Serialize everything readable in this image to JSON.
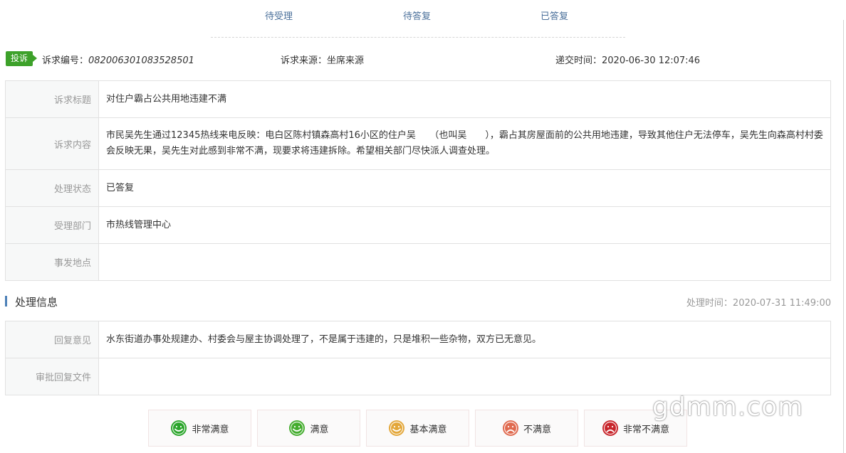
{
  "tabs": [
    "待受理",
    "待答复",
    "已答复"
  ],
  "meta": {
    "badge": "投诉",
    "id_label": "诉求编号：",
    "id_value": "082006301083528501",
    "source": "诉求来源：坐席来源",
    "time": "递交时间：2020-06-30 12:07:46"
  },
  "details": [
    {
      "label": "诉求标题",
      "value": "对住户霸占公共用地违建不满"
    },
    {
      "label": "诉求内容",
      "value": "市民吴先生通过12345热线来电反映：电白区陈村镇森高村16小区的住户吴　　（也叫吴　　），霸占其房屋面前的公共用地违建，导致其他住户无法停车，吴先生向森高村村委会反映无果，吴先生对此感到非常不满，现要求将违建拆除。希望相关部门尽快派人调查处理。"
    },
    {
      "label": "处理状态",
      "value": "已答复"
    },
    {
      "label": "受理部门",
      "value": "市热线管理中心"
    },
    {
      "label": "事发地点",
      "value": ""
    }
  ],
  "processing": {
    "title": "处理信息",
    "time": "处理时间：2020-07-31 11:49:00",
    "rows": [
      {
        "label": "回复意见",
        "value": "水东街道办事处规建办、村委会与屋主协调处理了，不是属于违建的，只是堆积一些杂物，双方已无意见。"
      },
      {
        "label": "审批回复文件",
        "value": ""
      }
    ]
  },
  "ratings": [
    {
      "label": "非常满意",
      "color": "#2aa52a",
      "mouth": "smile"
    },
    {
      "label": "满意",
      "color": "#44ad2e",
      "mouth": "smile"
    },
    {
      "label": "基本满意",
      "color": "#e3a73a",
      "mouth": "smile"
    },
    {
      "label": "不满意",
      "color": "#e06a4f",
      "mouth": "frown"
    },
    {
      "label": "非常不满意",
      "color": "#c8262c",
      "mouth": "frown"
    }
  ],
  "watermark": "gdmm.com"
}
